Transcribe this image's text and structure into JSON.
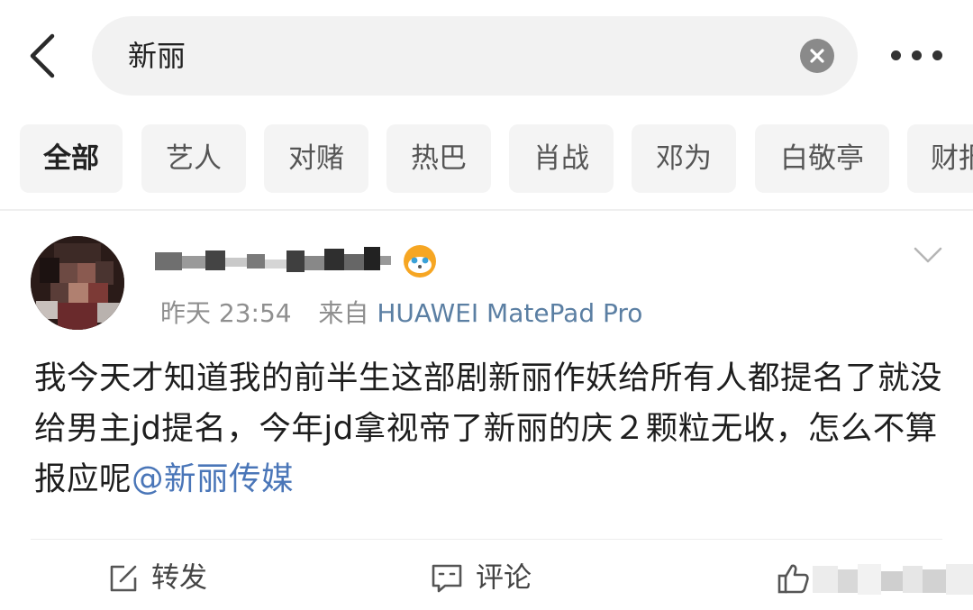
{
  "search": {
    "query": "新丽"
  },
  "categories": [
    "全部",
    "艺人",
    "对赌",
    "热巴",
    "肖战",
    "邓为",
    "白敬亭",
    "财报"
  ],
  "post": {
    "time": "昨天 23:54",
    "source_prefix": "来自",
    "device": "HUAWEI MatePad Pro",
    "content": "我今天才知道我的前半生这部剧新丽作妖给所有人都提名了就没给男主jd提名，今年jd拿视帝了新丽的庆２颗粒无收，怎么不算报应呢",
    "mention": "@新丽传媒"
  },
  "actions": {
    "repost_label": "转发",
    "comment_label": "评论",
    "like_count": "1"
  },
  "icons": {
    "back": "chevron-left-icon",
    "clear": "clear-circle-icon",
    "more": "more-dots-icon",
    "badge": "fox-badge-icon",
    "dropdown": "chevron-down-icon",
    "repost": "share-square-icon",
    "comment": "comment-bubble-icon",
    "like": "thumbs-up-icon"
  },
  "colors": {
    "link": "#4a76b8",
    "device": "#5b7fa3",
    "meta": "#8f8f8f"
  }
}
